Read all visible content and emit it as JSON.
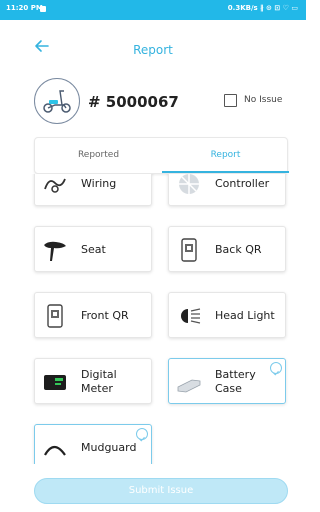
{
  "status_bar": {
    "time": "11:20 PM",
    "right": "0.3KB/s ∦ ⊙ ⊡ ♡ ▭"
  },
  "header": {
    "title": "Report"
  },
  "vehicle": {
    "number": "# 5000067",
    "no_issue_label": "No Issue"
  },
  "tabs": [
    {
      "label": "Reported"
    },
    {
      "label": "Report"
    }
  ],
  "items": [
    {
      "label": "Wiring",
      "icon": "wiring-icon",
      "selected": false
    },
    {
      "label": "Controller",
      "icon": "controller-icon",
      "selected": false
    },
    {
      "label": "Seat",
      "icon": "seat-icon",
      "selected": false
    },
    {
      "label": "Back QR",
      "icon": "qr-sticker-icon",
      "selected": false
    },
    {
      "label": "Front QR",
      "icon": "qr-sticker-icon",
      "selected": false
    },
    {
      "label": "Head Light",
      "icon": "headlight-icon",
      "selected": false
    },
    {
      "label": "Digital Meter",
      "icon": "digital-meter-icon",
      "selected": false
    },
    {
      "label": "Battery Case",
      "icon": "battery-case-icon",
      "selected": true
    },
    {
      "label": "Mudguard",
      "icon": "mudguard-icon",
      "selected": true
    }
  ],
  "submit_label": "Submit Issue",
  "colors": {
    "status_bar": "#22b8e8",
    "accent": "#35b3df",
    "submit_bg": "#bfe8f7",
    "selected_border": "#7ccbeb"
  }
}
